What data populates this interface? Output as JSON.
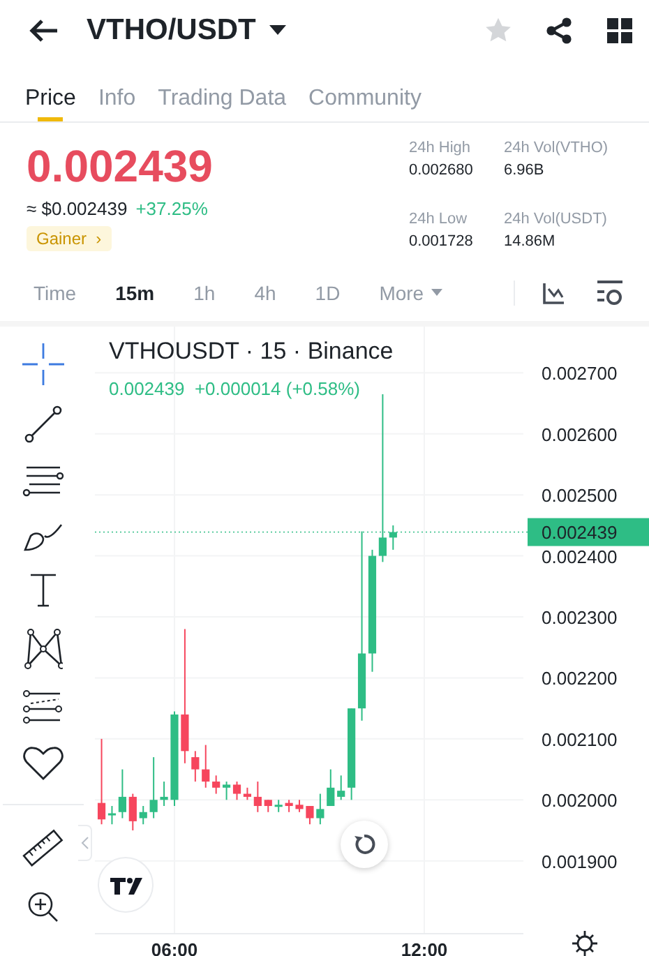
{
  "header": {
    "pair": "VTHO/USDT",
    "favorite": false
  },
  "tabs": [
    {
      "label": "Price",
      "selected": true
    },
    {
      "label": "Info",
      "selected": false
    },
    {
      "label": "Trading Data",
      "selected": false
    },
    {
      "label": "Community",
      "selected": false
    }
  ],
  "price": {
    "last": "0.002439",
    "fiat": "≈ $0.002439",
    "change": "+37.25%",
    "tag": "Gainer",
    "tag_arrow": "›"
  },
  "stats": [
    {
      "label": "24h High",
      "value": "0.002680"
    },
    {
      "label": "24h Vol(VTHO)",
      "value": "6.96B"
    },
    {
      "label": "24h Low",
      "value": "0.001728"
    },
    {
      "label": "24h Vol(USDT)",
      "value": "14.86M"
    }
  ],
  "intervals": [
    {
      "label": "Time",
      "selected": false
    },
    {
      "label": "15m",
      "selected": true
    },
    {
      "label": "1h",
      "selected": false
    },
    {
      "label": "4h",
      "selected": false
    },
    {
      "label": "1D",
      "selected": false
    },
    {
      "label": "More",
      "selected": false,
      "dropdown": true
    }
  ],
  "chart": {
    "title": "VTHOUSDT · 15 · Binance",
    "legend_price": "0.002439",
    "legend_change": "+0.000014 (+0.58%)",
    "last_label": "0.002439",
    "price_axis": [
      "0.002700",
      "0.002600",
      "0.002500",
      "0.002400",
      "0.002300",
      "0.002200",
      "0.002100",
      "0.002000",
      "0.001900"
    ],
    "time_axis": [
      "06:00",
      "12:00"
    ]
  }
}
